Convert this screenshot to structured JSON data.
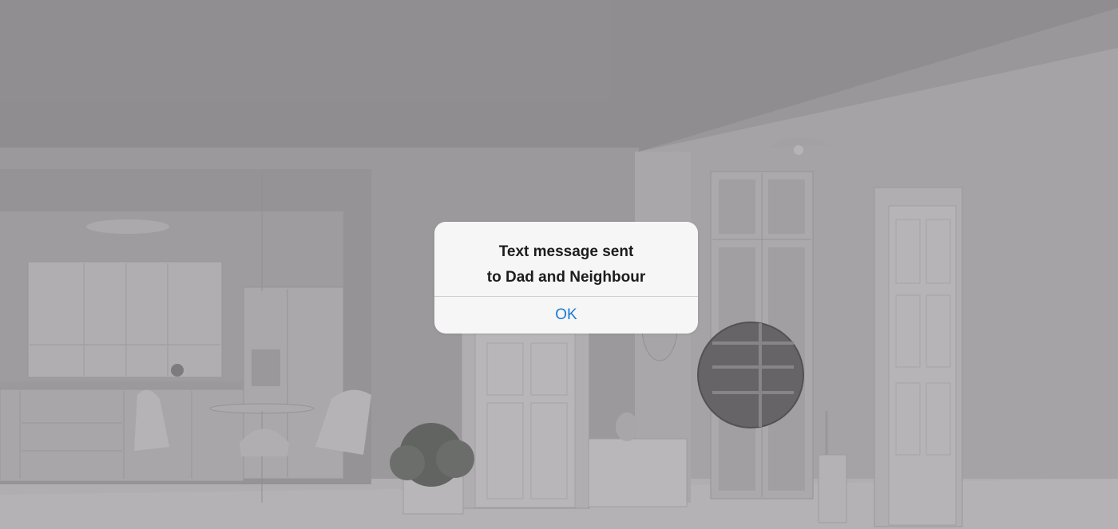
{
  "alert": {
    "title_line1": "Text message sent",
    "title_line2": "to Dad and Neighbour",
    "ok_label": "OK"
  },
  "colors": {
    "dialog_background": "#f6f6f6",
    "button_text": "#1a7ad4",
    "title_text": "#1c1c1c",
    "overlay": "rgba(40,36,40,0.18)"
  },
  "background": {
    "description_icon": "room-interior-image"
  }
}
